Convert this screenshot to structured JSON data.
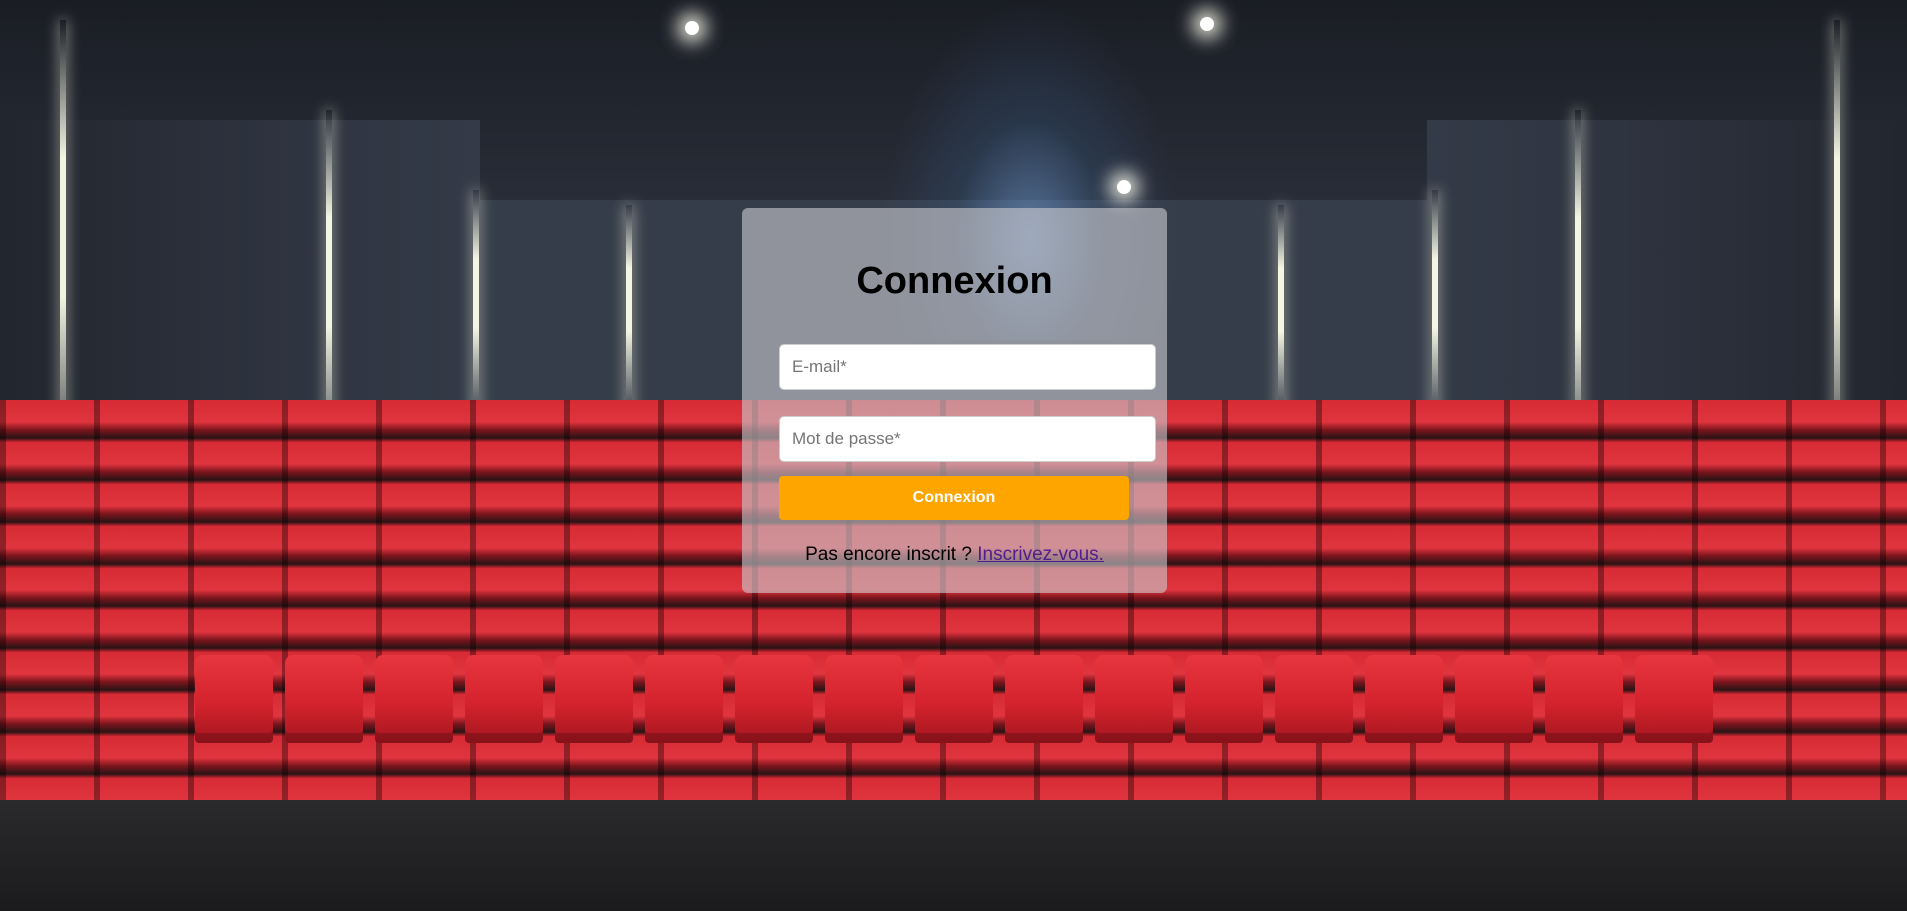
{
  "login": {
    "title": "Connexion",
    "email_placeholder": "E-mail*",
    "password_placeholder": "Mot de passe*",
    "submit_label": "Connexion",
    "signup_prompt": "Pas encore inscrit ?",
    "signup_link": "Inscrivez-vous."
  },
  "colors": {
    "button": "#ffa500",
    "link_visited": "#551a8b",
    "panel_overlay": "rgba(200,200,205,0.62)"
  }
}
